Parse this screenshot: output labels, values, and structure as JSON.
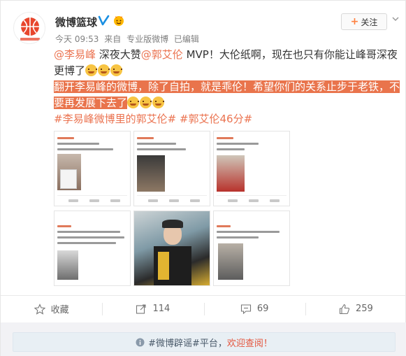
{
  "account": {
    "name": "微博篮球",
    "avatar_caption": "微博篮球"
  },
  "meta": {
    "time": "今天 09:53",
    "from_prefix": "来自",
    "source": "专业版微博",
    "edited": "已编辑"
  },
  "follow_label": "关注",
  "post": {
    "mention1": "@李易峰",
    "text1": " 深夜大赞",
    "mention2": "@郭艾伦",
    "text2": " MVP！大伦纸啊，现在也只有你能让峰哥深夜更博了",
    "highlight": "翻开李易峰的微博，除了自拍，就是乖伦！希望你们的关系止步于老铁，不要再发展下去了",
    "topic1": "#李易峰微博里的郭艾伦#",
    "topic2": "#郭艾伦46分#"
  },
  "actions": {
    "favorite": "收藏",
    "repost_count": "114",
    "comment_count": "69",
    "like_count": "259"
  },
  "notice": {
    "text1": "#微博辟谣#平台，",
    "text2": "欢迎查阅！"
  },
  "colors": {
    "accent": "#eb7350",
    "highlight_bg": "#e9744c",
    "notice_bg": "#e8eff4"
  },
  "icons": [
    "weibo-basketball-logo",
    "verified-v-icon",
    "vip-icon",
    "chevron-down-icon",
    "star-icon",
    "repost-icon",
    "comment-icon",
    "like-icon",
    "info-icon"
  ]
}
